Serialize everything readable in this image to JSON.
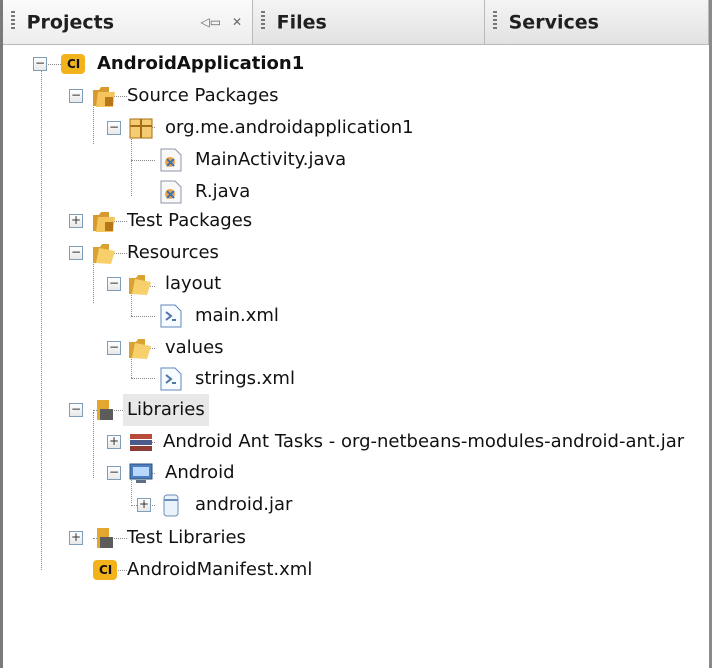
{
  "tabs": [
    {
      "label": "Projects",
      "active": true
    },
    {
      "label": "Files",
      "active": false
    },
    {
      "label": "Services",
      "active": false
    }
  ],
  "project_tab_controls": {
    "restore_icon": "restore-window-icon",
    "close_icon": "close-icon"
  },
  "tree": [
    {
      "label": "AndroidApplication1",
      "icon": "android-project-icon",
      "expanded": true,
      "level": 0,
      "bold": true
    },
    {
      "label": "Source Packages",
      "icon": "source-packages-folder-icon",
      "expanded": true,
      "level": 1
    },
    {
      "label": "org.me.androidapplication1",
      "icon": "package-icon",
      "expanded": true,
      "level": 2
    },
    {
      "label": "MainActivity.java",
      "icon": "java-file-icon",
      "level": 3
    },
    {
      "label": "R.java",
      "icon": "java-file-icon",
      "level": 3
    },
    {
      "label": "Test Packages",
      "icon": "test-packages-folder-icon",
      "expanded": false,
      "level": 1
    },
    {
      "label": "Resources",
      "icon": "resources-folder-icon",
      "expanded": true,
      "level": 1
    },
    {
      "label": "layout",
      "icon": "folder-icon",
      "expanded": true,
      "level": 2
    },
    {
      "label": "main.xml",
      "icon": "xml-file-icon",
      "level": 3
    },
    {
      "label": "values",
      "icon": "folder-icon",
      "expanded": true,
      "level": 2
    },
    {
      "label": "strings.xml",
      "icon": "xml-file-icon",
      "level": 3
    },
    {
      "label": "Libraries",
      "icon": "libraries-icon",
      "expanded": true,
      "level": 1,
      "selected": true
    },
    {
      "label": "Android Ant Tasks - org-netbeans-modules-android-ant.jar",
      "icon": "library-jar-icon",
      "expanded": false,
      "level": 2
    },
    {
      "label": "Android",
      "icon": "android-platform-icon",
      "expanded": true,
      "level": 2
    },
    {
      "label": "android.jar",
      "icon": "jar-icon",
      "expanded": false,
      "level": 3
    },
    {
      "label": "Test Libraries",
      "icon": "libraries-icon",
      "expanded": false,
      "level": 1
    },
    {
      "label": "AndroidManifest.xml",
      "icon": "android-manifest-icon",
      "level": 1
    }
  ]
}
